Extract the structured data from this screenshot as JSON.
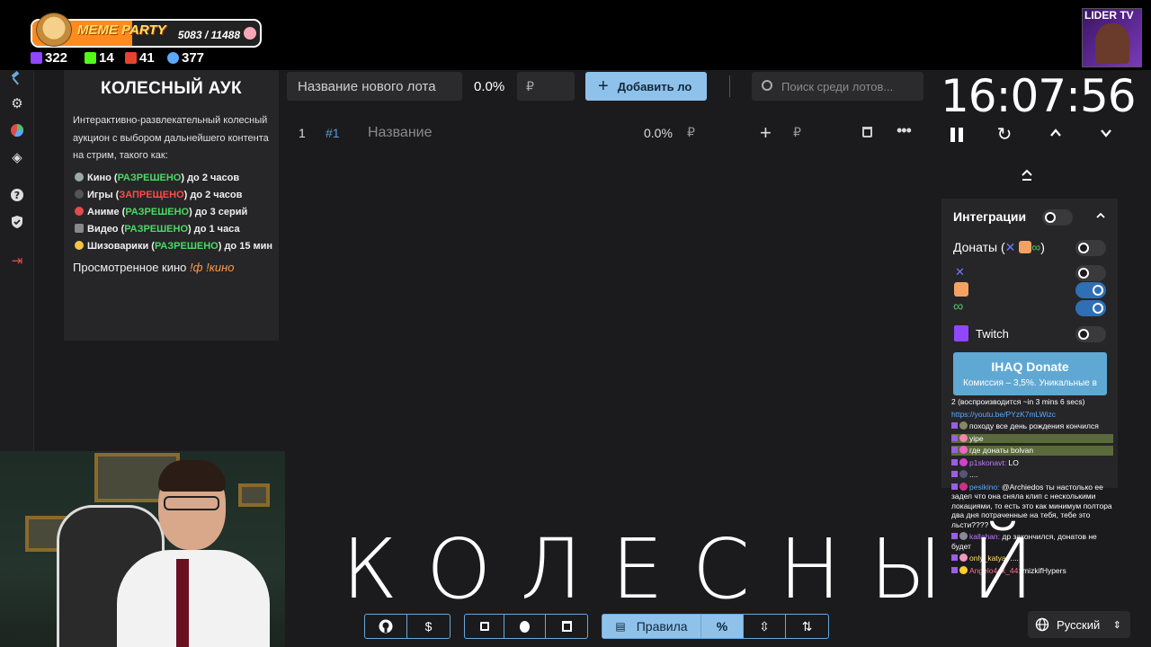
{
  "overlay": {
    "meme_party": {
      "title": "MEME PARTY",
      "current": 5083,
      "total": 11488,
      "count_text": "5083 / 11488",
      "progress": 0.44
    },
    "stats": [
      {
        "icon": "twitch-icon",
        "value": "322",
        "color": "#9146ff"
      },
      {
        "icon": "kick-icon",
        "value": "14",
        "color": "#53fc18"
      },
      {
        "icon": "live-icon",
        "value": "41",
        "color": "#e8432e"
      },
      {
        "icon": "viewers-icon",
        "value": "377",
        "color": "#5aa9ff"
      }
    ],
    "channel_logo": "LIDER TV",
    "caption": "КОЛЕСНЫЙ"
  },
  "sidebar": {
    "items": [
      {
        "icon": "auction-hammer-icon"
      },
      {
        "icon": "gear-icon"
      },
      {
        "icon": "wheel-icon"
      },
      {
        "icon": "layers-icon"
      },
      {
        "icon": "help-icon"
      },
      {
        "icon": "shield-icon"
      },
      {
        "icon": "logout-icon"
      }
    ]
  },
  "info_panel": {
    "title": "КОЛЕСНЫЙ АУК",
    "description": "Интерактивно-развлекательный колесный аукцион с выбором дальнейшего контента на стрим, такого как:",
    "rules": [
      {
        "name": "Кино (",
        "status": "РАЗРЕШЕНО",
        "allowed": true,
        "limit": ") до 2 часов"
      },
      {
        "name": "Игры (",
        "status": "ЗАПРЕЩЕНО",
        "allowed": false,
        "limit": ") до 2 часов"
      },
      {
        "name": "Аниме (",
        "status": "РАЗРЕШЕНО",
        "allowed": true,
        "limit": ") до 3 серий"
      },
      {
        "name": "Видео (",
        "status": "РАЗРЕШЕНО",
        "allowed": true,
        "limit": ") до 1 часа"
      },
      {
        "name": "Шизоварики (",
        "status": "РАЗРЕШЕНО",
        "allowed": true,
        "limit": ") до 15 мин"
      }
    ],
    "footer_text": "Просмотренное кино",
    "footer_cmd": "!ф !кино"
  },
  "toolbar": {
    "lot_name_placeholder": "Название нового лота",
    "lot_percent": "0.0%",
    "currency": "₽",
    "add_button": "Добавить ло",
    "search_placeholder": "Поиск среди лотов..."
  },
  "lots": [
    {
      "index": "1",
      "id": "#1",
      "name": "Название",
      "percent": "0.0%",
      "currency": "₽"
    }
  ],
  "timer": {
    "value": "16:07:56"
  },
  "integrations": {
    "title": "Интеграции",
    "donations_label": "Донаты (",
    "donations_suffix": ")",
    "twitch_label": "Twitch",
    "ihaq": {
      "title": "IHAQ Donate",
      "subtitle": "Комиссия – 3,5%. Уникальные в"
    },
    "toggles": {
      "master": false,
      "donations": false,
      "x": false,
      "donatepay": true,
      "donatty": true,
      "twitch": false
    }
  },
  "chat": [
    {
      "user": "",
      "user_color": "#ffffff",
      "text": "2 (воспроизводится ~in 3 mins 6 secs)"
    },
    {
      "user": "",
      "user_color": "#5aa9ff",
      "text": "https://youtu.be/PYzK7mLWizc"
    },
    {
      "user": "",
      "user_color": "#ffffff",
      "text": "походу все день рождения кончился"
    },
    {
      "user": "",
      "user_color": "#c07aff",
      "text": "yipe"
    },
    {
      "user": "",
      "user_color": "#5aa9ff",
      "text": "где донаты bolvan"
    },
    {
      "user": "p1skonavt:",
      "user_color": "#c07aff",
      "text": "LO"
    },
    {
      "user": "",
      "user_color": "#5aa9ff",
      "text": "...."
    },
    {
      "user": "pesikino:",
      "user_color": "#5aa9ff",
      "text": "@Archiedos ты настолько ее задел что она сняла клип с несколькими локациями, то есть это как минимум полтора два дня потраченные на тебя, тебе это льсти????"
    },
    {
      "user": "kallahan:",
      "user_color": "#c07aff",
      "text": "др закончился, донатов не будет"
    },
    {
      "user": "only_katya:",
      "user_color": "#ffe066",
      "text": "...."
    },
    {
      "user": "Angelo4ek_44:",
      "user_color": "#ff6b8a",
      "text": "mizkifHypers"
    }
  ],
  "bottom_bar": {
    "rules_label": "Правила",
    "language": "Русский"
  }
}
